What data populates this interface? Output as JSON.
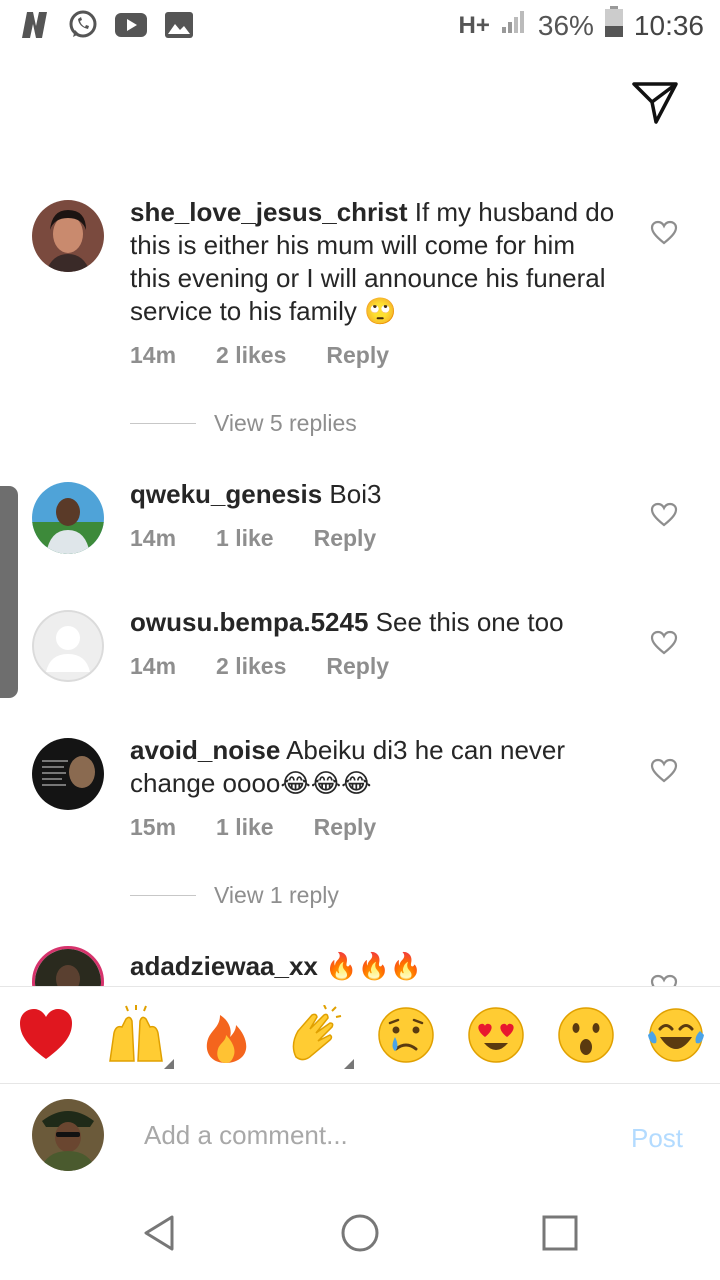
{
  "status_bar": {
    "network": "H+",
    "battery": "36%",
    "time": "10:36",
    "left_icons": [
      "netflix-icon",
      "whatsapp-icon",
      "youtube-icon",
      "gallery-icon"
    ]
  },
  "comments": [
    {
      "username": "she_love_jesus_christ",
      "text": " If my husband do this is either his mum will come for him this evening or I will announce his funeral service to his family 🙄",
      "time": "14m",
      "likes": "2 likes",
      "reply": "Reply",
      "view_replies": "View 5 replies"
    },
    {
      "username": "qweku_genesis",
      "text": " Boi3",
      "time": "14m",
      "likes": "1 like",
      "reply": "Reply"
    },
    {
      "username": "owusu.bempa.5245",
      "text": " See this one too",
      "time": "14m",
      "likes": "2 likes",
      "reply": "Reply"
    },
    {
      "username": "avoid_noise",
      "text": " Abeiku di3 he can never change oooo😂😂😂",
      "time": "15m",
      "likes": "1 like",
      "reply": "Reply",
      "view_replies": "View 1 reply"
    },
    {
      "username": "adadziewaa_xx",
      "text": " 🔥🔥🔥"
    }
  ],
  "emoji_bar": [
    {
      "icon": "red-heart-icon",
      "char": "❤️"
    },
    {
      "icon": "raising-hands-icon",
      "char": "🙌"
    },
    {
      "icon": "fire-icon",
      "char": "🔥"
    },
    {
      "icon": "clapping-hands-icon",
      "char": "👏"
    },
    {
      "icon": "crying-face-icon",
      "char": "😢"
    },
    {
      "icon": "heart-eyes-icon",
      "char": "😍"
    },
    {
      "icon": "surprised-face-icon",
      "char": "😮"
    },
    {
      "icon": "tears-of-joy-icon",
      "char": "😂"
    }
  ],
  "composer": {
    "placeholder": "Add a comment...",
    "post_label": "Post"
  }
}
